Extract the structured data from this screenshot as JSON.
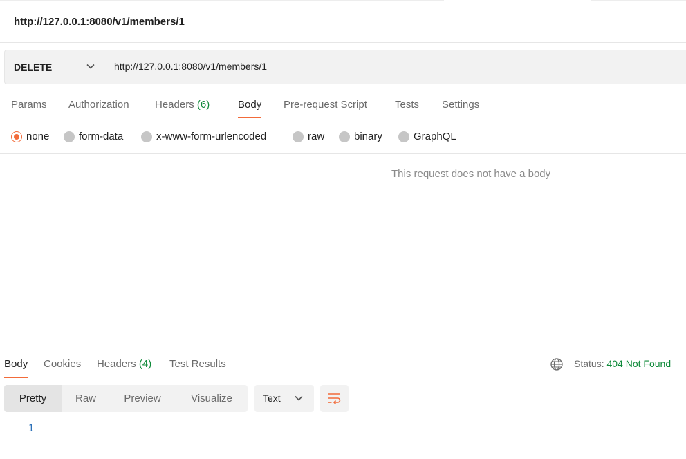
{
  "request_title": "http://127.0.0.1:8080/v1/members/1",
  "request": {
    "method": "DELETE",
    "url": "http://127.0.0.1:8080/v1/members/1"
  },
  "request_tabs": {
    "params": "Params",
    "authorization": "Authorization",
    "headers": "Headers",
    "headers_count": "(6)",
    "body": "Body",
    "pre_request_script": "Pre-request Script",
    "tests": "Tests",
    "settings": "Settings",
    "active": "Body"
  },
  "body_types": {
    "none": "none",
    "form_data": "form-data",
    "urlencoded": "x-www-form-urlencoded",
    "raw": "raw",
    "binary": "binary",
    "graphql": "GraphQL",
    "selected": "none"
  },
  "body_empty_message": "This request does not have a body",
  "response_tabs": {
    "body": "Body",
    "cookies": "Cookies",
    "headers": "Headers",
    "headers_count": "(4)",
    "test_results": "Test Results",
    "active": "Body"
  },
  "response_status": {
    "label": "Status:",
    "value": "404 Not Found"
  },
  "view_modes": {
    "pretty": "Pretty",
    "raw": "Raw",
    "preview": "Preview",
    "visualize": "Visualize",
    "active": "Pretty"
  },
  "format": "Text",
  "editor": {
    "line_numbers": [
      "1"
    ]
  },
  "icons": {
    "method_dropdown": "chevron-down-icon",
    "globe": "globe-icon",
    "format_dropdown": "chevron-down-icon",
    "wrap": "wrap-lines-icon"
  },
  "colors": {
    "accent": "#f26b3a",
    "success_green": "#0f8a3a",
    "line_number": "#2a6fb8"
  }
}
